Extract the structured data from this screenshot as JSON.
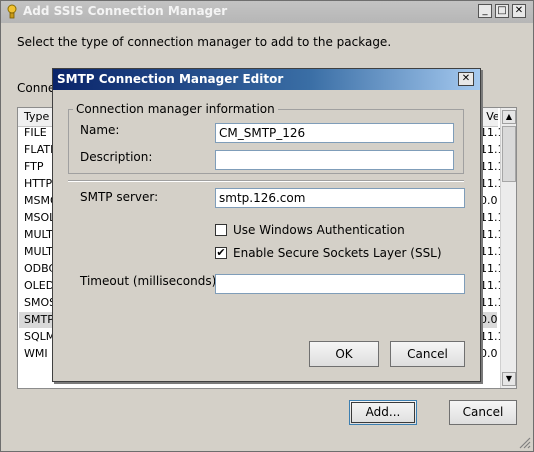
{
  "outer": {
    "title": "Add SSIS Connection Manager",
    "prompt": "Select the type of connection manager to add to the package.",
    "connection_label": "Connec",
    "list": {
      "col_type": "Type",
      "col_version": "e Ver",
      "rows": [
        {
          "type": "FILE",
          "version": "11.1"
        },
        {
          "type": "FLATF",
          "version": "11.1"
        },
        {
          "type": "FTP",
          "version": "11.1"
        },
        {
          "type": "HTTP",
          "version": "11.1"
        },
        {
          "type": "MSMQ",
          "version": "0.0"
        },
        {
          "type": "MSOLA",
          "version": "11.1"
        },
        {
          "type": "MULTI",
          "version": "11.1"
        },
        {
          "type": "MULTI",
          "version": "11.1"
        },
        {
          "type": "ODBC",
          "version": "11.1"
        },
        {
          "type": "OLEDE",
          "version": "11.1"
        },
        {
          "type": "SMOS",
          "version": "11.1"
        },
        {
          "type": "SMTP",
          "version": "0.0"
        },
        {
          "type": "SQLMO",
          "version": "11.1"
        },
        {
          "type": "WMI",
          "version": "0.0"
        }
      ],
      "selected_row": "SMTP"
    },
    "add_button": "Add...",
    "cancel_button": "Cancel",
    "icons": {
      "window": "ssis-window-icon",
      "minimize": "minimize-icon",
      "maximize": "maximize-icon",
      "close": "close-icon",
      "grip": "resize-grip-icon"
    }
  },
  "modal": {
    "title": "SMTP Connection Manager Editor",
    "group_title": "Connection manager information",
    "name_label": "Name:",
    "name_value": "CM_SMTP_126",
    "description_label": "Description:",
    "description_value": "",
    "smtp_label": "SMTP server:",
    "smtp_value": "smtp.126.com",
    "windows_auth_label": "Use Windows Authentication",
    "windows_auth_checked": false,
    "ssl_label": "Enable Secure Sockets Layer (SSL)",
    "ssl_checked": true,
    "timeout_label": "Timeout (milliseconds):",
    "timeout_value": "",
    "ok_button": "OK",
    "cancel_button": "Cancel"
  },
  "colors": {
    "modal_title_start": "#0a246a",
    "modal_title_end": "#a6caf0",
    "dialog_face": "#d4d0c8"
  }
}
